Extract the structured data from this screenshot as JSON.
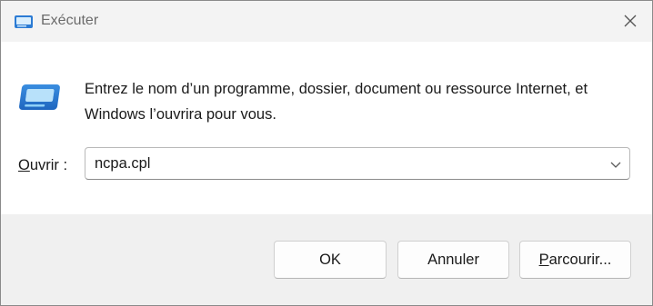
{
  "window": {
    "title": "Exécuter"
  },
  "dialog": {
    "description": "Entrez le nom d’un programme, dossier, document ou ressource Internet, et Windows l’ouvrira pour vous.",
    "open_label_accel": "O",
    "open_label_rest": "uvrir :",
    "open_value": "ncpa.cpl"
  },
  "buttons": {
    "ok_label": "OK",
    "cancel_label": "Annuler",
    "browse_accel": "P",
    "browse_rest": "arcourir..."
  },
  "icons": {
    "title_icon": "run-icon",
    "content_icon": "run-icon",
    "close": "close-icon",
    "dropdown": "chevron-down-icon"
  },
  "colors": {
    "icon_blue": "#2b7bd4",
    "icon_light": "#5ab4f0"
  }
}
